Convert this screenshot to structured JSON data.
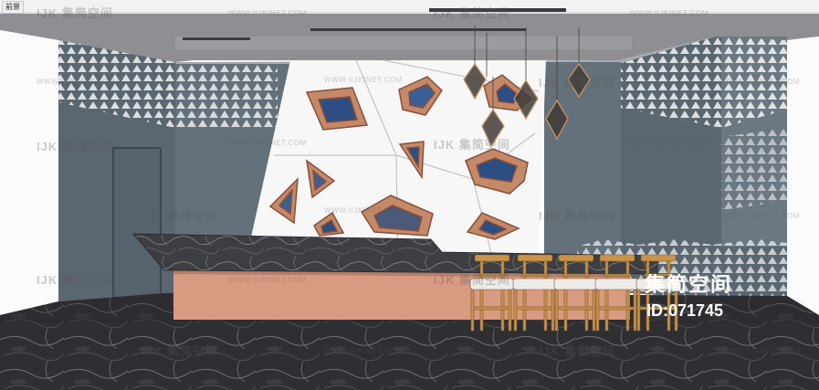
{
  "scene_tab": "前景",
  "watermark_url": "WWW.IIJKINET.COM",
  "watermark_logo": "IJK 集简空间",
  "brand_text": "集简空间",
  "id_text": "ID:071745"
}
